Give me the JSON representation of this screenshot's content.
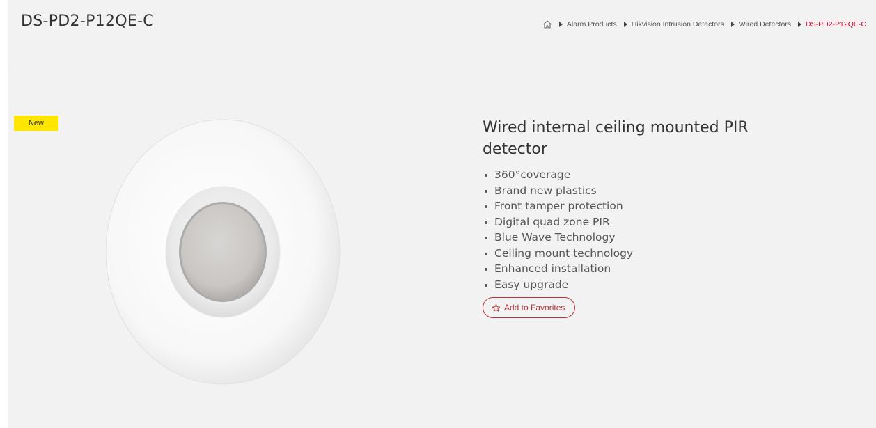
{
  "header": {
    "title": "DS-PD2-P12QE-C",
    "breadcrumb": {
      "home_icon": "home-icon",
      "items": [
        "Alarm Products",
        "Hikvision Intrusion Detectors",
        "Wired Detectors"
      ],
      "current": "DS-PD2-P12QE-C"
    }
  },
  "product": {
    "badge": "New",
    "heading": "Wired internal ceiling mounted PIR detector",
    "features": [
      "360°coverage",
      "Brand new plastics",
      "Front tamper protection",
      "Digital quad zone PIR",
      "Blue Wave Technology",
      "Ceiling mount technology",
      "Enhanced installation",
      "Easy upgrade"
    ],
    "favorite_label": "Add to Favorites",
    "favorite_icon": "star-icon"
  },
  "colors": {
    "background": "#f2f2f2",
    "badge": "#ffe600",
    "accent": "#c8102e",
    "button_border": "#b5343a"
  }
}
